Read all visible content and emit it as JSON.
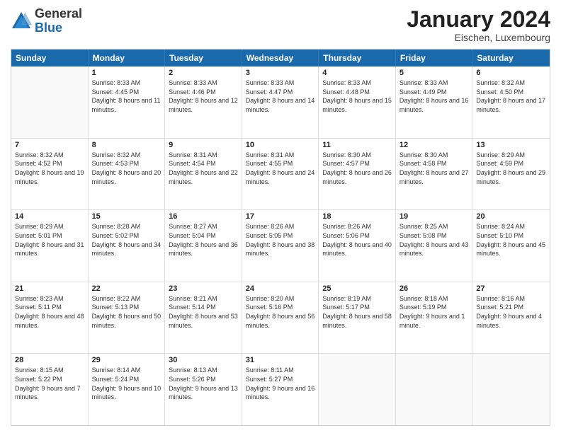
{
  "header": {
    "logo": {
      "line1": "General",
      "line2": "Blue"
    },
    "title": "January 2024",
    "subtitle": "Eischen, Luxembourg"
  },
  "days_of_week": [
    "Sunday",
    "Monday",
    "Tuesday",
    "Wednesday",
    "Thursday",
    "Friday",
    "Saturday"
  ],
  "weeks": [
    [
      {
        "num": "",
        "sunrise": "",
        "sunset": "",
        "daylight": "",
        "empty": true
      },
      {
        "num": "1",
        "sunrise": "Sunrise: 8:33 AM",
        "sunset": "Sunset: 4:45 PM",
        "daylight": "Daylight: 8 hours and 11 minutes.",
        "empty": false
      },
      {
        "num": "2",
        "sunrise": "Sunrise: 8:33 AM",
        "sunset": "Sunset: 4:46 PM",
        "daylight": "Daylight: 8 hours and 12 minutes.",
        "empty": false
      },
      {
        "num": "3",
        "sunrise": "Sunrise: 8:33 AM",
        "sunset": "Sunset: 4:47 PM",
        "daylight": "Daylight: 8 hours and 14 minutes.",
        "empty": false
      },
      {
        "num": "4",
        "sunrise": "Sunrise: 8:33 AM",
        "sunset": "Sunset: 4:48 PM",
        "daylight": "Daylight: 8 hours and 15 minutes.",
        "empty": false
      },
      {
        "num": "5",
        "sunrise": "Sunrise: 8:33 AM",
        "sunset": "Sunset: 4:49 PM",
        "daylight": "Daylight: 8 hours and 16 minutes.",
        "empty": false
      },
      {
        "num": "6",
        "sunrise": "Sunrise: 8:32 AM",
        "sunset": "Sunset: 4:50 PM",
        "daylight": "Daylight: 8 hours and 17 minutes.",
        "empty": false
      }
    ],
    [
      {
        "num": "7",
        "sunrise": "Sunrise: 8:32 AM",
        "sunset": "Sunset: 4:52 PM",
        "daylight": "Daylight: 8 hours and 19 minutes.",
        "empty": false
      },
      {
        "num": "8",
        "sunrise": "Sunrise: 8:32 AM",
        "sunset": "Sunset: 4:53 PM",
        "daylight": "Daylight: 8 hours and 20 minutes.",
        "empty": false
      },
      {
        "num": "9",
        "sunrise": "Sunrise: 8:31 AM",
        "sunset": "Sunset: 4:54 PM",
        "daylight": "Daylight: 8 hours and 22 minutes.",
        "empty": false
      },
      {
        "num": "10",
        "sunrise": "Sunrise: 8:31 AM",
        "sunset": "Sunset: 4:55 PM",
        "daylight": "Daylight: 8 hours and 24 minutes.",
        "empty": false
      },
      {
        "num": "11",
        "sunrise": "Sunrise: 8:30 AM",
        "sunset": "Sunset: 4:57 PM",
        "daylight": "Daylight: 8 hours and 26 minutes.",
        "empty": false
      },
      {
        "num": "12",
        "sunrise": "Sunrise: 8:30 AM",
        "sunset": "Sunset: 4:58 PM",
        "daylight": "Daylight: 8 hours and 27 minutes.",
        "empty": false
      },
      {
        "num": "13",
        "sunrise": "Sunrise: 8:29 AM",
        "sunset": "Sunset: 4:59 PM",
        "daylight": "Daylight: 8 hours and 29 minutes.",
        "empty": false
      }
    ],
    [
      {
        "num": "14",
        "sunrise": "Sunrise: 8:29 AM",
        "sunset": "Sunset: 5:01 PM",
        "daylight": "Daylight: 8 hours and 31 minutes.",
        "empty": false
      },
      {
        "num": "15",
        "sunrise": "Sunrise: 8:28 AM",
        "sunset": "Sunset: 5:02 PM",
        "daylight": "Daylight: 8 hours and 34 minutes.",
        "empty": false
      },
      {
        "num": "16",
        "sunrise": "Sunrise: 8:27 AM",
        "sunset": "Sunset: 5:04 PM",
        "daylight": "Daylight: 8 hours and 36 minutes.",
        "empty": false
      },
      {
        "num": "17",
        "sunrise": "Sunrise: 8:26 AM",
        "sunset": "Sunset: 5:05 PM",
        "daylight": "Daylight: 8 hours and 38 minutes.",
        "empty": false
      },
      {
        "num": "18",
        "sunrise": "Sunrise: 8:26 AM",
        "sunset": "Sunset: 5:06 PM",
        "daylight": "Daylight: 8 hours and 40 minutes.",
        "empty": false
      },
      {
        "num": "19",
        "sunrise": "Sunrise: 8:25 AM",
        "sunset": "Sunset: 5:08 PM",
        "daylight": "Daylight: 8 hours and 43 minutes.",
        "empty": false
      },
      {
        "num": "20",
        "sunrise": "Sunrise: 8:24 AM",
        "sunset": "Sunset: 5:10 PM",
        "daylight": "Daylight: 8 hours and 45 minutes.",
        "empty": false
      }
    ],
    [
      {
        "num": "21",
        "sunrise": "Sunrise: 8:23 AM",
        "sunset": "Sunset: 5:11 PM",
        "daylight": "Daylight: 8 hours and 48 minutes.",
        "empty": false
      },
      {
        "num": "22",
        "sunrise": "Sunrise: 8:22 AM",
        "sunset": "Sunset: 5:13 PM",
        "daylight": "Daylight: 8 hours and 50 minutes.",
        "empty": false
      },
      {
        "num": "23",
        "sunrise": "Sunrise: 8:21 AM",
        "sunset": "Sunset: 5:14 PM",
        "daylight": "Daylight: 8 hours and 53 minutes.",
        "empty": false
      },
      {
        "num": "24",
        "sunrise": "Sunrise: 8:20 AM",
        "sunset": "Sunset: 5:16 PM",
        "daylight": "Daylight: 8 hours and 56 minutes.",
        "empty": false
      },
      {
        "num": "25",
        "sunrise": "Sunrise: 8:19 AM",
        "sunset": "Sunset: 5:17 PM",
        "daylight": "Daylight: 8 hours and 58 minutes.",
        "empty": false
      },
      {
        "num": "26",
        "sunrise": "Sunrise: 8:18 AM",
        "sunset": "Sunset: 5:19 PM",
        "daylight": "Daylight: 9 hours and 1 minute.",
        "empty": false
      },
      {
        "num": "27",
        "sunrise": "Sunrise: 8:16 AM",
        "sunset": "Sunset: 5:21 PM",
        "daylight": "Daylight: 9 hours and 4 minutes.",
        "empty": false
      }
    ],
    [
      {
        "num": "28",
        "sunrise": "Sunrise: 8:15 AM",
        "sunset": "Sunset: 5:22 PM",
        "daylight": "Daylight: 9 hours and 7 minutes.",
        "empty": false
      },
      {
        "num": "29",
        "sunrise": "Sunrise: 8:14 AM",
        "sunset": "Sunset: 5:24 PM",
        "daylight": "Daylight: 9 hours and 10 minutes.",
        "empty": false
      },
      {
        "num": "30",
        "sunrise": "Sunrise: 8:13 AM",
        "sunset": "Sunset: 5:26 PM",
        "daylight": "Daylight: 9 hours and 13 minutes.",
        "empty": false
      },
      {
        "num": "31",
        "sunrise": "Sunrise: 8:11 AM",
        "sunset": "Sunset: 5:27 PM",
        "daylight": "Daylight: 9 hours and 16 minutes.",
        "empty": false
      },
      {
        "num": "",
        "sunrise": "",
        "sunset": "",
        "daylight": "",
        "empty": true
      },
      {
        "num": "",
        "sunrise": "",
        "sunset": "",
        "daylight": "",
        "empty": true
      },
      {
        "num": "",
        "sunrise": "",
        "sunset": "",
        "daylight": "",
        "empty": true
      }
    ]
  ]
}
